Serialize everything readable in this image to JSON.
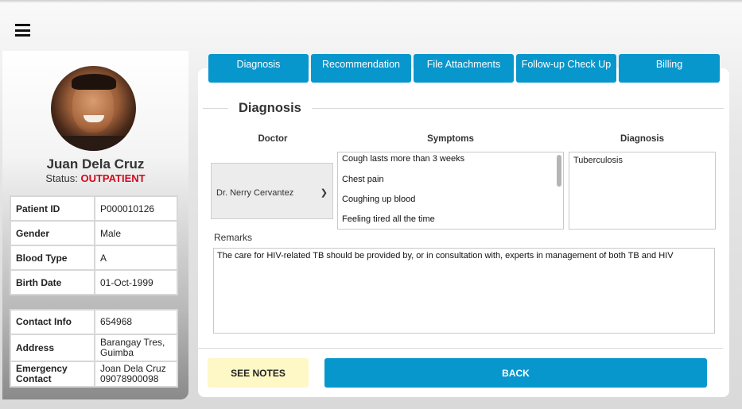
{
  "tabs": [
    {
      "label": "Diagnosis"
    },
    {
      "label": "Recommendation"
    },
    {
      "label": "File Attachments"
    },
    {
      "label": "Follow-up Check Up"
    },
    {
      "label": "Billing"
    }
  ],
  "patient": {
    "name": "Juan Dela Cruz",
    "status_label": "Status: ",
    "status_value": "OUTPATIENT",
    "info": [
      {
        "label": "Patient ID",
        "value": "P000010126"
      },
      {
        "label": "Gender",
        "value": "Male"
      },
      {
        "label": "Blood Type",
        "value": "A"
      },
      {
        "label": "Birth Date",
        "value": "01-Oct-1999"
      }
    ],
    "contact": [
      {
        "label": "Contact Info",
        "value": "654968"
      },
      {
        "label": "Address",
        "value": "Barangay Tres, Guimba"
      },
      {
        "label": "Emergency Contact",
        "value": "Joan Dela Cruz 09078900098"
      }
    ]
  },
  "diagnosis": {
    "title": "Diagnosis",
    "headers": {
      "doctor": "Doctor",
      "symptoms": "Symptoms",
      "diagnosis": "Diagnosis"
    },
    "doctor_selected": "Dr. Nerry Cervantez",
    "symptoms": [
      "Cough lasts more than 3 weeks",
      "Chest pain",
      "Coughing up blood",
      "Feeling tired all the time"
    ],
    "diagnosis_value": "Tuberculosis",
    "remarks_label": "Remarks",
    "remarks_value": "The care for HIV-related TB should be provided by, or in consultation with, experts in management of both TB and HIV"
  },
  "actions": {
    "see_notes": "SEE NOTES",
    "back": "BACK"
  },
  "icons": {
    "menu": "hamburger-menu-icon",
    "select": "chevron-down-icon"
  },
  "colors": {
    "accent": "#0897cd",
    "status": "#d00a1e",
    "notes_bg": "#fdf8c6"
  }
}
